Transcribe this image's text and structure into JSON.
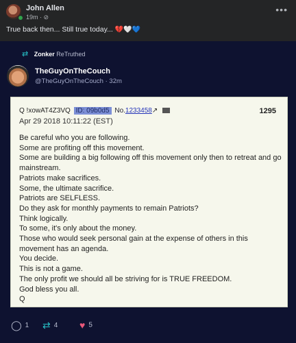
{
  "header": {
    "name": "John Allen",
    "time": "19m",
    "visibility_glyph": "·",
    "text": "True back then... Still true today...",
    "hearts": [
      "💔",
      "🤍",
      "💙"
    ]
  },
  "retruth": {
    "by": "Zonker",
    "label": "ReTruthed"
  },
  "author": {
    "display_name": "TheGuyOnTheCouch",
    "handle": "@TheGuyOnTheCouch",
    "age": "32m"
  },
  "qpost": {
    "poster": "Q !xowAT4Z3VQ",
    "id_label": "ID: 09b0d5",
    "no_label": "No.",
    "no_value": "1233458",
    "number": "1295",
    "date": "Apr 29 2018 10:11:22 (EST)",
    "lines": [
      "Be careful who you are following.",
      "Some are profiting off this movement.",
      "Some are building a big following off this movement only then to retreat and go mainstream.",
      "Patriots make sacrifices.",
      "Some, the ultimate sacrifice.",
      "Patriots are SELFLESS.",
      "Do they ask for monthly payments to remain Patriots?",
      "Think logically.",
      "To some, it's only about the money.",
      "Those who would seek personal gain at the expense of others in this movement has an agenda.",
      "You decide.",
      "This is not a game.",
      "The only profit we should all be striving for is TRUE FREEDOM.",
      "God bless you all.",
      "Q"
    ]
  },
  "actions": {
    "replies": "1",
    "retruths": "4",
    "likes": "5"
  },
  "colors": {
    "facebook_bg": "#242526",
    "truth_bg": "#0e1230",
    "retruth_accent": "#27c2c8",
    "like_accent": "#e9587a",
    "id_highlight": "#7c8fd6"
  }
}
